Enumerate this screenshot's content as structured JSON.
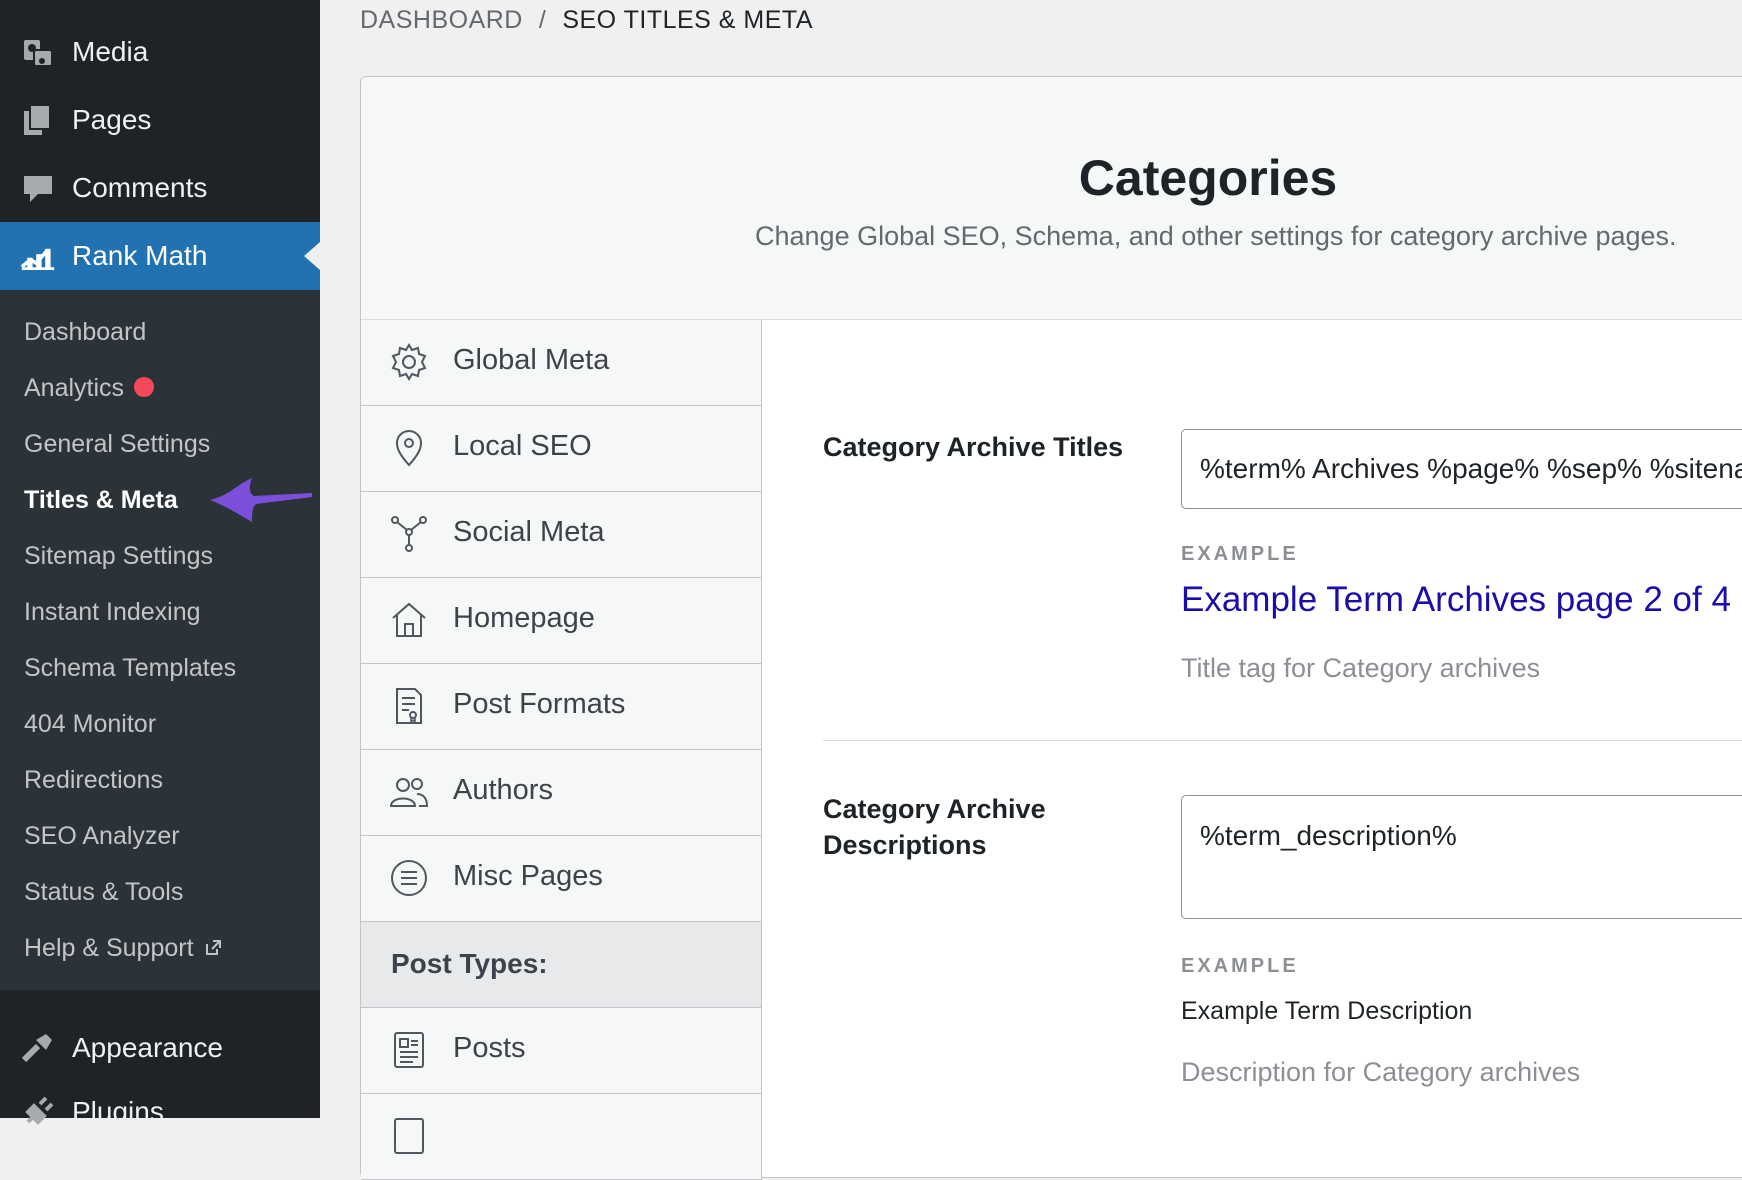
{
  "sidebar": {
    "top_items": [
      {
        "label": "Media",
        "icon": "media-icon"
      },
      {
        "label": "Pages",
        "icon": "pages-icon"
      },
      {
        "label": "Comments",
        "icon": "comments-icon"
      },
      {
        "label": "Rank Math",
        "icon": "rank-math-icon"
      }
    ],
    "submenu": [
      {
        "label": "Dashboard"
      },
      {
        "label": "Analytics"
      },
      {
        "label": "General Settings"
      },
      {
        "label": "Titles & Meta"
      },
      {
        "label": "Sitemap Settings"
      },
      {
        "label": "Instant Indexing"
      },
      {
        "label": "Schema Templates"
      },
      {
        "label": "404 Monitor"
      },
      {
        "label": "Redirections"
      },
      {
        "label": "SEO Analyzer"
      },
      {
        "label": "Status & Tools"
      },
      {
        "label": "Help & Support"
      }
    ],
    "bottom_items": [
      {
        "label": "Appearance",
        "icon": "appearance-icon"
      },
      {
        "label": "Plugins",
        "icon": "plugins-icon"
      }
    ],
    "colors": {
      "active_bg": "#2271b1",
      "analytics_dot": "#f5485b",
      "annotation_arrow": "#7b4fd9"
    }
  },
  "breadcrumb": {
    "parent": "DASHBOARD",
    "separator": "/",
    "current": "SEO TITLES & META"
  },
  "header": {
    "title": "Categories",
    "description": "Change Global SEO, Schema, and other settings for category archive pages."
  },
  "tabs": [
    {
      "label": "Global Meta",
      "icon": "gear-icon"
    },
    {
      "label": "Local SEO",
      "icon": "map-pin-icon"
    },
    {
      "label": "Social Meta",
      "icon": "share-nodes-icon"
    },
    {
      "label": "Homepage",
      "icon": "home-icon"
    },
    {
      "label": "Post Formats",
      "icon": "document-icon"
    },
    {
      "label": "Authors",
      "icon": "users-icon"
    },
    {
      "label": "Misc Pages",
      "icon": "list-circle-icon"
    },
    {
      "label": "Post Types:",
      "icon": ""
    },
    {
      "label": "Posts",
      "icon": "post-icon"
    }
  ],
  "fields": {
    "titles": {
      "label": "Category Archive Titles",
      "value": "%term% Archives %page% %sep% %sitename%",
      "example_label": "EXAMPLE",
      "example_value": "Example Term Archives page 2 of 4",
      "help": "Title tag for Category archives"
    },
    "descriptions": {
      "label_line1": "Category Archive",
      "label_line2": "Descriptions",
      "value": "%term_description%",
      "example_label": "EXAMPLE",
      "example_value": "Example Term Description",
      "help": "Description for Category archives"
    }
  }
}
